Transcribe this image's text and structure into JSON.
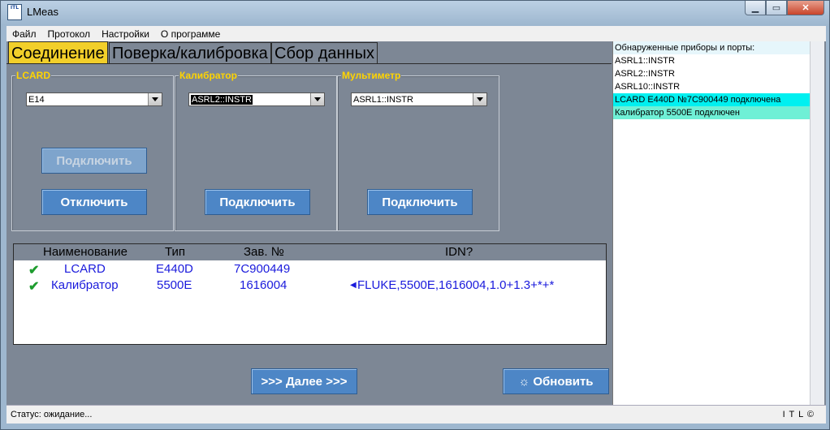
{
  "window": {
    "title": "LMeas",
    "icon_text": "ITL"
  },
  "menu": [
    "Файл",
    "Протокол",
    "Настройки",
    "О программе"
  ],
  "tabs": [
    {
      "label": "Соединение",
      "active": true
    },
    {
      "label": "Поверка/калибровка",
      "active": false
    },
    {
      "label": "Сбор данных",
      "active": false
    }
  ],
  "groups": {
    "lcard": {
      "title": "LCARD",
      "combo_value": "E14",
      "connect_label": "Подключить",
      "connect_enabled": false,
      "disconnect_label": "Отключить"
    },
    "calibrator": {
      "title": "Калибратор",
      "combo_value": "ASRL2::INSTR",
      "connect_label": "Подключить"
    },
    "multimeter": {
      "title": "Мультиметр",
      "combo_value": "ASRL1::INSTR",
      "connect_label": "Подключить"
    }
  },
  "devices": {
    "columns": [
      "Наименование",
      "Тип",
      "Зав. №",
      "IDN?"
    ],
    "rows": [
      {
        "name": "LCARD",
        "type": "E440D",
        "serial": "7C900449",
        "idn": ""
      },
      {
        "name": "Калибратор",
        "type": "5500E",
        "serial": "1616004",
        "idn": "FLUKE,5500E,1616004,1.0+1.3+*+*"
      }
    ]
  },
  "buttons": {
    "next_label": ">>> Далее >>>",
    "refresh_label": "☼ Обновить"
  },
  "log": {
    "header": "Обнаруженные приборы и порты:",
    "lines": [
      "ASRL1::INSTR",
      "ASRL2::INSTR",
      "ASRL10::INSTR"
    ],
    "highlight1": "LCARD E440D №7C900449 подключена",
    "highlight2": "Калибратор 5500E подключен"
  },
  "status": {
    "text": "Статус: ожидание...",
    "copyright": "I T L ©"
  },
  "colors": {
    "active_tab": "#f2cf2a",
    "group_title": "#ffd400",
    "button": "#4d86c6",
    "device_text": "#1a1adc"
  }
}
